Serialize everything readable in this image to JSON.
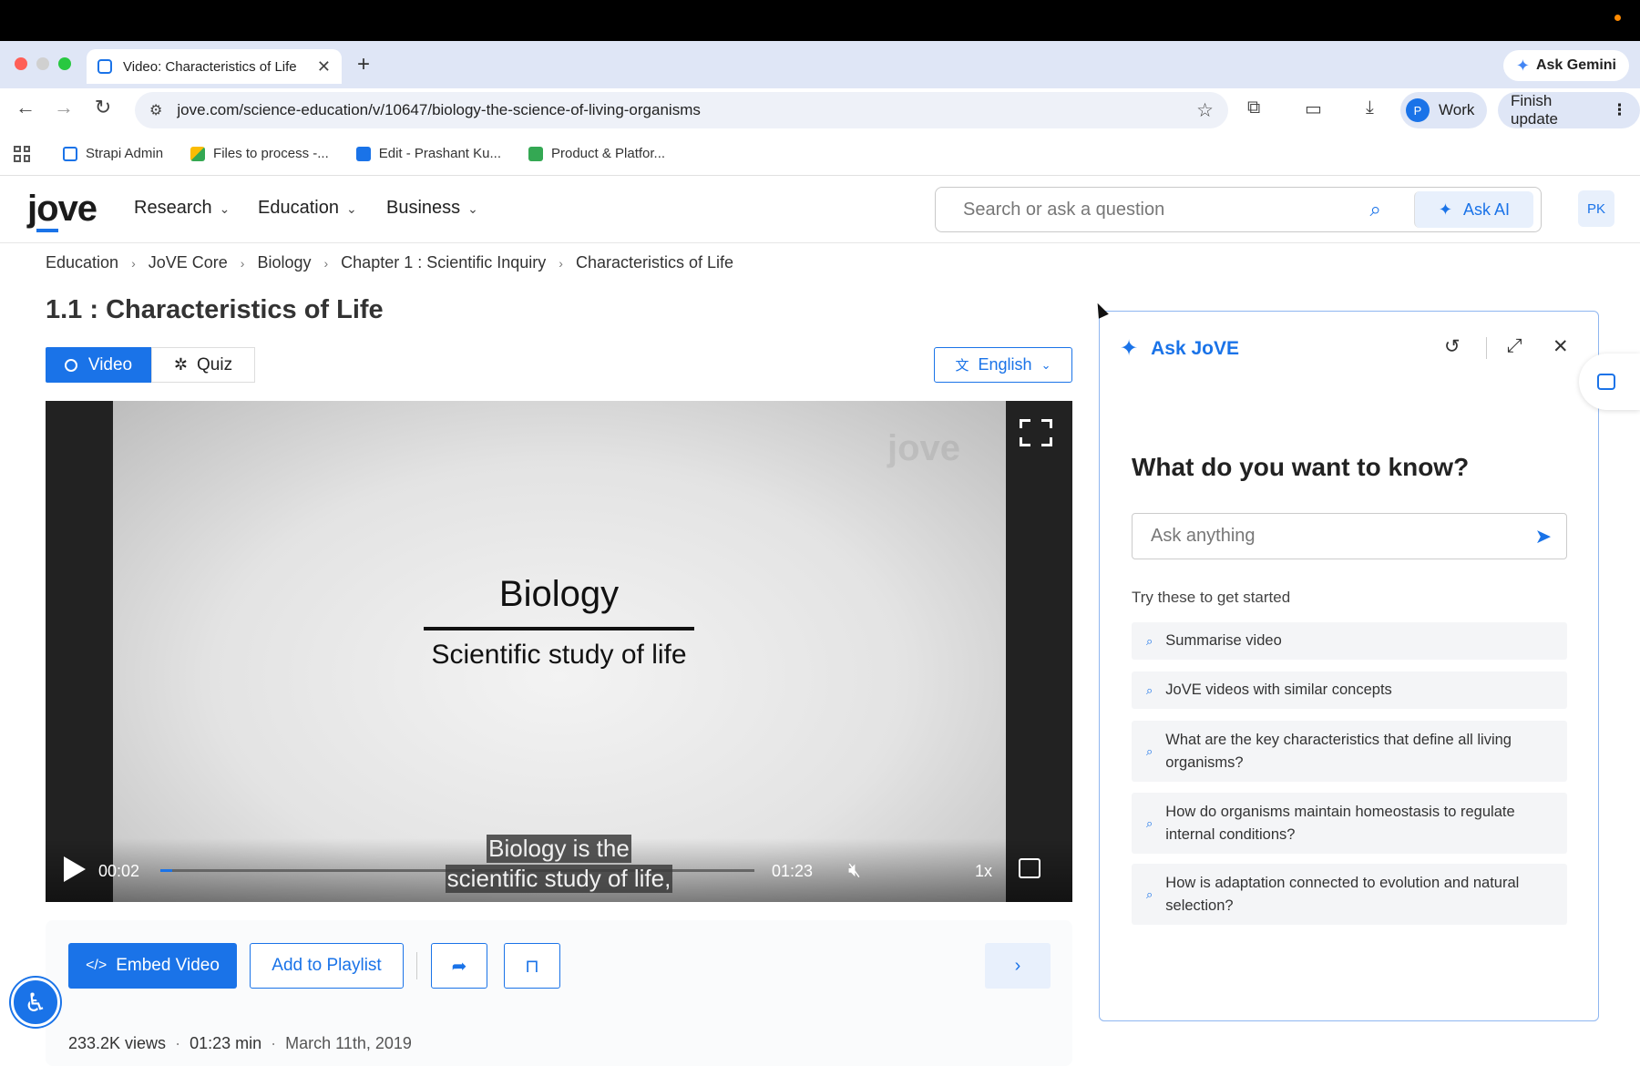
{
  "browser": {
    "tab_title": "Video: Characteristics of Life",
    "url": "jove.com/science-education/v/10647/biology-the-science-of-living-organisms",
    "gemini_label": "Ask Gemini",
    "profile_initial": "P",
    "profile_label": "Work",
    "update_label": "Finish update",
    "bookmarks": [
      {
        "label": "Strapi Admin",
        "color": "#1a73e8"
      },
      {
        "label": "Files to process -...",
        "color": "#fbbc04"
      },
      {
        "label": "Edit - Prashant Ku...",
        "color": "#1a73e8"
      },
      {
        "label": "Product & Platfor...",
        "color": "#34a853"
      }
    ]
  },
  "site": {
    "logo_pre": "j",
    "logo_o": "o",
    "logo_post": "ve",
    "nav": [
      "Research",
      "Education",
      "Business"
    ],
    "search_placeholder": "Search or ask a question",
    "ask_ai_label": "Ask AI",
    "user_initials": "PK"
  },
  "breadcrumb": [
    "Education",
    "JoVE Core",
    "Biology",
    "Chapter 1 : Scientific Inquiry",
    "Characteristics of Life"
  ],
  "page_title": "1.1 : Characteristics of Life",
  "tabs": {
    "video": "Video",
    "quiz": "Quiz"
  },
  "language": "English",
  "video": {
    "watermark": "jove",
    "slide_title": "Biology",
    "slide_subtitle": "Scientific study of life",
    "current_time": "00:02",
    "duration": "01:23",
    "progress": 0.02,
    "speed": "1x",
    "caption_line1": "Biology is the",
    "caption_line2": "scientific study of life,"
  },
  "actions": {
    "embed": "Embed Video",
    "playlist": "Add to Playlist"
  },
  "meta": {
    "views": "233.2K views",
    "length": "01:23 min",
    "date": "March 11th, 2019"
  },
  "ask_panel": {
    "title": "Ask JoVE",
    "question": "What do you want to know?",
    "input_placeholder": "Ask anything",
    "try_label": "Try these to get started",
    "suggestions": [
      "Summarise video",
      "JoVE videos with similar concepts",
      "What are the key characteristics that define all living organisms?",
      "How do organisms maintain homeostasis to regulate internal conditions?",
      "How is adaptation connected to evolution and natural selection?"
    ]
  },
  "colors": {
    "accent": "#1a73e8"
  }
}
